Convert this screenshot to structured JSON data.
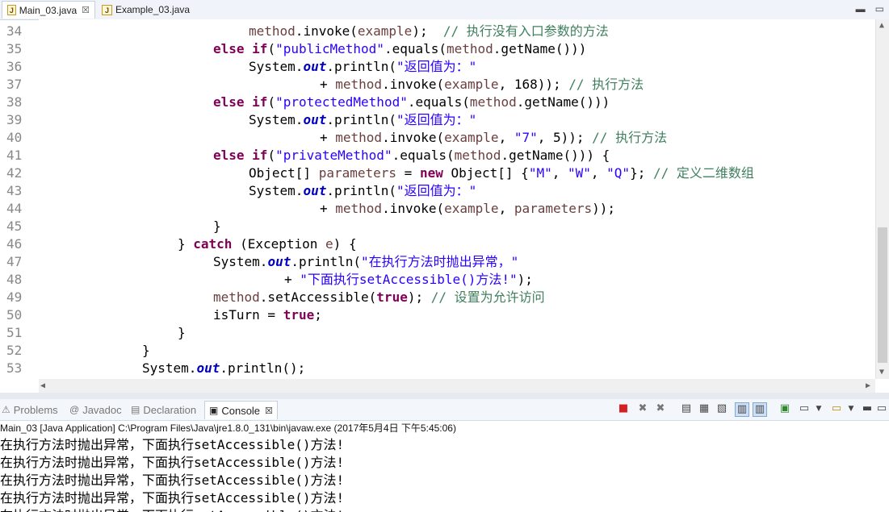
{
  "editor": {
    "tabs": [
      {
        "label": "Main_03.java",
        "close": "☒"
      },
      {
        "label": "Example_03.java"
      }
    ],
    "lines": [
      {
        "n": "34",
        "tokens": [
          [
            "var",
            "method"
          ],
          [
            "",
            "."
          ],
          [
            "",
            "invoke"
          ],
          [
            "",
            "("
          ],
          [
            "var",
            "example"
          ],
          [
            "",
            ");"
          ],
          [
            "",
            "  "
          ],
          [
            "cm",
            "// 执行没有入口参数的方法"
          ]
        ]
      },
      {
        "n": "35",
        "tokens": [
          [
            "kw",
            "else"
          ],
          [
            "",
            " "
          ],
          [
            "kw",
            "if"
          ],
          [
            "",
            "("
          ],
          [
            "str",
            "\"publicMethod\""
          ],
          [
            "",
            ".equals("
          ],
          [
            "var",
            "method"
          ],
          [
            "",
            ".getName()))"
          ]
        ]
      },
      {
        "n": "36",
        "tokens": [
          [
            "",
            "System."
          ],
          [
            "fld",
            "out"
          ],
          [
            "",
            ".println("
          ],
          [
            "str",
            "\"返回值为：\""
          ]
        ]
      },
      {
        "n": "37",
        "tokens": [
          [
            "",
            "+ "
          ],
          [
            "var",
            "method"
          ],
          [
            "",
            ".invoke("
          ],
          [
            "var",
            "example"
          ],
          [
            "",
            ", 168)); "
          ],
          [
            "cm",
            "// 执行方法"
          ]
        ]
      },
      {
        "n": "38",
        "tokens": [
          [
            "kw",
            "else"
          ],
          [
            "",
            " "
          ],
          [
            "kw",
            "if"
          ],
          [
            "",
            "("
          ],
          [
            "str",
            "\"protectedMethod\""
          ],
          [
            "",
            ".equals("
          ],
          [
            "var",
            "method"
          ],
          [
            "",
            ".getName()))"
          ]
        ]
      },
      {
        "n": "39",
        "tokens": [
          [
            "",
            "System."
          ],
          [
            "fld",
            "out"
          ],
          [
            "",
            ".println("
          ],
          [
            "str",
            "\"返回值为：\""
          ]
        ]
      },
      {
        "n": "40",
        "tokens": [
          [
            "",
            "+ "
          ],
          [
            "var",
            "method"
          ],
          [
            "",
            ".invoke("
          ],
          [
            "var",
            "example"
          ],
          [
            "",
            ", "
          ],
          [
            "str",
            "\"7\""
          ],
          [
            "",
            ", 5)); "
          ],
          [
            "cm",
            "// 执行方法"
          ]
        ]
      },
      {
        "n": "41",
        "tokens": [
          [
            "kw",
            "else"
          ],
          [
            "",
            " "
          ],
          [
            "kw",
            "if"
          ],
          [
            "",
            "("
          ],
          [
            "str",
            "\"privateMethod\""
          ],
          [
            "",
            ".equals("
          ],
          [
            "var",
            "method"
          ],
          [
            "",
            ".getName())) {"
          ]
        ]
      },
      {
        "n": "42",
        "tokens": [
          [
            "",
            "Object[] "
          ],
          [
            "var",
            "parameters"
          ],
          [
            "",
            " = "
          ],
          [
            "kw",
            "new"
          ],
          [
            "",
            " Object[] {"
          ],
          [
            "str",
            "\"M\""
          ],
          [
            "",
            ", "
          ],
          [
            "str",
            "\"W\""
          ],
          [
            "",
            ", "
          ],
          [
            "str",
            "\"Q\""
          ],
          [
            "",
            "}; "
          ],
          [
            "cm",
            "// 定义二维数组"
          ]
        ]
      },
      {
        "n": "43",
        "tokens": [
          [
            "",
            "System."
          ],
          [
            "fld",
            "out"
          ],
          [
            "",
            ".println("
          ],
          [
            "str",
            "\"返回值为：\""
          ]
        ]
      },
      {
        "n": "44",
        "tokens": [
          [
            "",
            "+ "
          ],
          [
            "var",
            "method"
          ],
          [
            "",
            ".invoke("
          ],
          [
            "var",
            "example"
          ],
          [
            "",
            ", "
          ],
          [
            "var",
            "parameters"
          ],
          [
            "",
            "));"
          ]
        ]
      },
      {
        "n": "45",
        "tokens": [
          [
            "",
            "}"
          ]
        ]
      },
      {
        "n": "46",
        "tokens": [
          [
            "",
            "} "
          ],
          [
            "kw",
            "catch"
          ],
          [
            "",
            " (Exception "
          ],
          [
            "var",
            "e"
          ],
          [
            "",
            ") {"
          ]
        ]
      },
      {
        "n": "47",
        "tokens": [
          [
            "",
            "System."
          ],
          [
            "fld",
            "out"
          ],
          [
            "",
            ".println("
          ],
          [
            "str",
            "\"在执行方法时抛出异常，\""
          ]
        ]
      },
      {
        "n": "48",
        "tokens": [
          [
            "",
            "+ "
          ],
          [
            "str",
            "\"下面执行setAccessible()方法!\""
          ],
          [
            "",
            ");"
          ]
        ]
      },
      {
        "n": "49",
        "tokens": [
          [
            "var",
            "method"
          ],
          [
            "",
            ".setAccessible("
          ],
          [
            "kw",
            "true"
          ],
          [
            "",
            "); "
          ],
          [
            "cm",
            "// 设置为允许访问"
          ]
        ]
      },
      {
        "n": "50",
        "tokens": [
          [
            "",
            "isTurn = "
          ],
          [
            "kw",
            "true"
          ],
          [
            "",
            ";"
          ]
        ]
      },
      {
        "n": "51",
        "tokens": [
          [
            "",
            "}"
          ]
        ]
      },
      {
        "n": "52",
        "tokens": [
          [
            "",
            "}"
          ]
        ]
      },
      {
        "n": "53",
        "tokens": [
          [
            "",
            "System."
          ],
          [
            "fld",
            "out"
          ],
          [
            "",
            ".println();"
          ]
        ]
      }
    ]
  },
  "views": {
    "tabs": [
      {
        "label": "Problems",
        "icon": "problems-icon"
      },
      {
        "label": "Javadoc",
        "icon": "javadoc-icon"
      },
      {
        "label": "Declaration",
        "icon": "declaration-icon"
      },
      {
        "label": "Console",
        "icon": "console-icon",
        "close": "☒"
      }
    ]
  },
  "console": {
    "launch": "Main_03 [Java Application] C:\\Program Files\\Java\\jre1.8.0_131\\bin\\javaw.exe (2017年5月4日 下午5:45:06)",
    "output": [
      "在执行方法时抛出异常，下面执行setAccessible()方法!",
      "在执行方法时抛出异常，下面执行setAccessible()方法!",
      "在执行方法时抛出异常，下面执行setAccessible()方法!",
      "在执行方法时抛出异常，下面执行setAccessible()方法!",
      "在执行方法时抛出异常，下面执行setAccessible()方法!"
    ]
  }
}
